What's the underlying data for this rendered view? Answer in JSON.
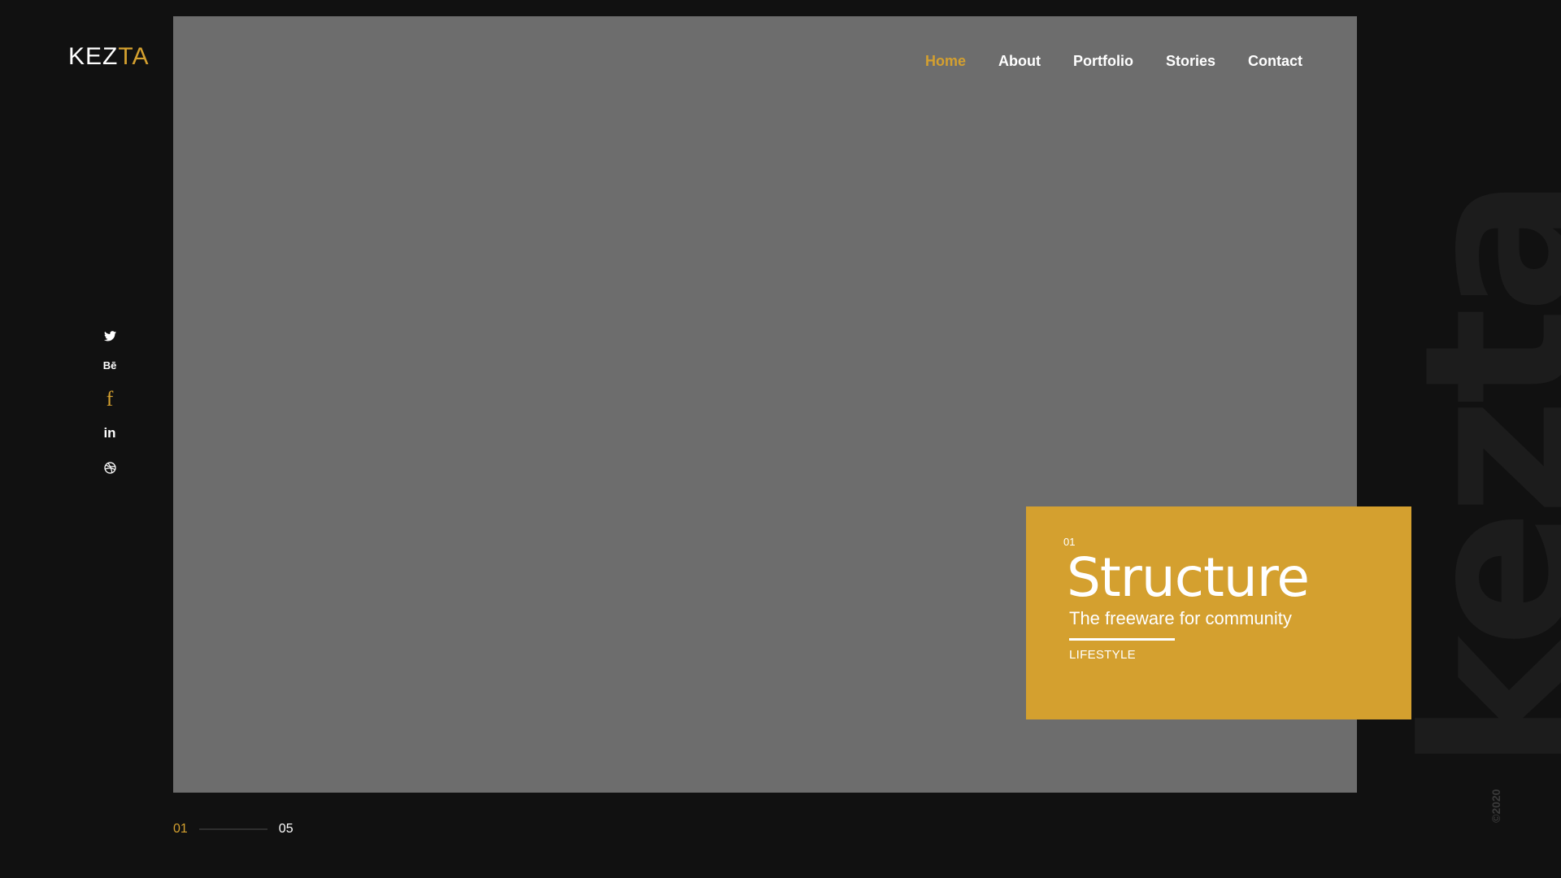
{
  "brand": {
    "logo_part1": "KEZ",
    "logo_part2": "TA",
    "accent_color": "#d4a02f"
  },
  "nav": {
    "items": [
      {
        "label": "Home",
        "active": true
      },
      {
        "label": "About",
        "active": false
      },
      {
        "label": "Portfolio",
        "active": false
      },
      {
        "label": "Stories",
        "active": false
      },
      {
        "label": "Contact",
        "active": false
      }
    ]
  },
  "social": {
    "icons": [
      "twitter-icon",
      "behance-icon",
      "facebook-icon",
      "linkedin-icon",
      "dribbble-icon"
    ],
    "behance_label": "Bē",
    "facebook_label": "f",
    "linkedin_label": "in"
  },
  "slide": {
    "number": "01",
    "title": "Structure",
    "subtitle": "The freeware for community",
    "tag": "LIFESTYLE"
  },
  "pager": {
    "current": "01",
    "total": "05"
  },
  "watermark": {
    "text": "kezta"
  },
  "footer": {
    "copyright": "©2020"
  }
}
